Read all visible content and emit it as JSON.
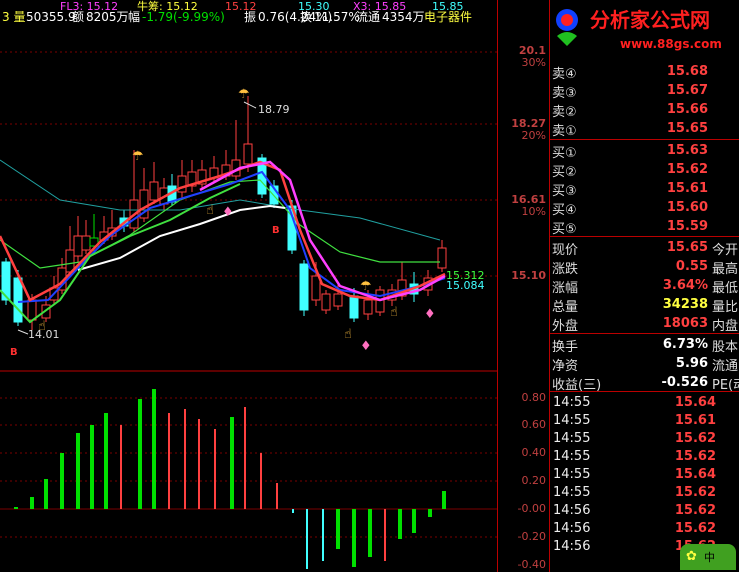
{
  "header": {
    "line1_left": "FL3: 15.12",
    "line1_mid": "牛筹: 15.12",
    "line1_mid2": "15.12",
    "line1_right": "15.30",
    "line1_x3": "X3: 15.85",
    "line1_end": "15.85",
    "line2_prefix": "3 量",
    "volume": "50355.9",
    "amount_label": "额",
    "amount": "8205万",
    "range_label": "幅",
    "range_val": "-1.79(-9.99%)",
    "amp_label": "振",
    "amp_val": "0.76(4.24%)",
    "turnover_label": "换",
    "turnover_val": "11.57%",
    "float_label": "流通",
    "float_val": "4354万",
    "sector": "电子器件"
  },
  "chart_labels": {
    "high_price": "18.79",
    "low_price": "14.01",
    "marker_b": "B",
    "ma_value_a": "15.312",
    "ma_value_b": "15.084"
  },
  "price_axis": {
    "ticks": [
      {
        "price": "20.1",
        "pct": "30%"
      },
      {
        "price": "18.27",
        "pct": "20%"
      },
      {
        "price": "16.61",
        "pct": "10%"
      },
      {
        "price": "15.10",
        "pct": ""
      }
    ]
  },
  "osc_axis": {
    "ticks": [
      "0.80",
      "0.60",
      "0.40",
      "0.20",
      "-0.00",
      "-0.20",
      "-0.40"
    ]
  },
  "logo": {
    "title": "分析家公式网",
    "url": "www.88gs.com"
  },
  "order_book": {
    "sell": [
      {
        "label": "卖④",
        "price": "15.68"
      },
      {
        "label": "卖③",
        "price": "15.67"
      },
      {
        "label": "卖②",
        "price": "15.66"
      },
      {
        "label": "卖①",
        "price": "15.65"
      }
    ],
    "buy": [
      {
        "label": "买①",
        "price": "15.63"
      },
      {
        "label": "买②",
        "price": "15.62"
      },
      {
        "label": "买③",
        "price": "15.61"
      },
      {
        "label": "买④",
        "price": "15.60"
      },
      {
        "label": "买⑤",
        "price": "15.59"
      }
    ]
  },
  "quote": [
    {
      "label": "现价",
      "value": "15.65",
      "ext": "今开",
      "cls": "up"
    },
    {
      "label": "涨跌",
      "value": "0.55",
      "ext": "最高",
      "cls": "up"
    },
    {
      "label": "涨幅",
      "value": "3.64%",
      "ext": "最低",
      "cls": "up"
    },
    {
      "label": "总量",
      "value": "34238",
      "ext": "量比",
      "cls": "yellow"
    },
    {
      "label": "外盘",
      "value": "18063",
      "ext": "内盘",
      "cls": "up"
    }
  ],
  "stats": [
    {
      "label": "换手",
      "value": "6.73%",
      "ext": "股本",
      "cls": "white"
    },
    {
      "label": "净资",
      "value": "5.96",
      "ext": "流通",
      "cls": "white"
    },
    {
      "label": "收益(三)",
      "value": "-0.526",
      "ext": "PE(动",
      "cls": "white"
    }
  ],
  "ticks": [
    {
      "time": "14:55",
      "price": "15.64"
    },
    {
      "time": "14:55",
      "price": "15.61"
    },
    {
      "time": "14:55",
      "price": "15.62"
    },
    {
      "time": "14:55",
      "price": "15.62"
    },
    {
      "time": "14:55",
      "price": "15.64"
    },
    {
      "time": "14:55",
      "price": "15.62"
    },
    {
      "time": "14:56",
      "price": "15.62"
    },
    {
      "time": "14:56",
      "price": "15.62"
    },
    {
      "time": "14:56",
      "price": "15.62"
    }
  ],
  "colors": {
    "up": "#ff4040",
    "down": "#00e000",
    "cyan": "#40ffff",
    "magenta": "#ff40ff",
    "ma_white": "#ffffff",
    "ma_blue": "#2040ff",
    "ma_green": "#40e040",
    "ma_teal": "#20a0a0"
  }
}
